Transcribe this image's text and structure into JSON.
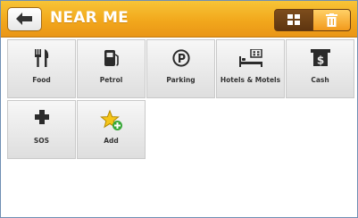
{
  "header": {
    "title": "NEAR ME",
    "back_icon": "left-arrow-icon",
    "view_grid_icon": "grid-icon",
    "delete_icon": "trash-icon"
  },
  "tiles": [
    {
      "label": "Food",
      "icon": "fork-knife-icon"
    },
    {
      "label": "Petrol",
      "icon": "fuel-pump-icon"
    },
    {
      "label": "Parking",
      "icon": "parking-icon"
    },
    {
      "label": "Hotels & Motels",
      "icon": "bed-icon"
    },
    {
      "label": "Cash",
      "icon": "atm-icon"
    },
    {
      "label": "SOS",
      "icon": "cross-icon"
    },
    {
      "label": "Add",
      "icon": "star-plus-icon"
    }
  ],
  "colors": {
    "header_orange": "#f2a81c",
    "toggle_brown": "#6a3d10",
    "add_green": "#3aa83a",
    "star_yellow": "#f5c518"
  }
}
